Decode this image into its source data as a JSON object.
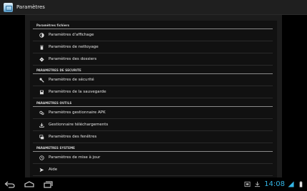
{
  "window": {
    "title": "Paramètres"
  },
  "sections": [
    {
      "header": "Paramètres fichiers",
      "items": [
        {
          "label": "Paramètres d'affichage",
          "icon": "display-icon"
        },
        {
          "label": "Paramètres de nettoyage",
          "icon": "trash-icon"
        },
        {
          "label": "Paramètres des dossiers",
          "icon": "folder-diamond-icon"
        }
      ]
    },
    {
      "header": "PARAMETRES DE SECURITE",
      "items": [
        {
          "label": "Paramètres de sécurité",
          "icon": "key-icon"
        },
        {
          "label": "Paramètres de la sauvegarde",
          "icon": "backup-icon"
        }
      ]
    },
    {
      "header": "PARAMETRES OUTILS",
      "items": [
        {
          "label": "Paramètres gestionnaire APK",
          "icon": "apk-gears-icon"
        },
        {
          "label": "Gestionnaire téléchargements",
          "icon": "download-icon"
        },
        {
          "label": "Paramètres des fenêtres",
          "icon": "windows-icon"
        }
      ]
    },
    {
      "header": "PARAMETRES SYSTEME",
      "items": [
        {
          "label": "Paramètres de mise à jour",
          "icon": "clock-icon"
        },
        {
          "label": "Aide",
          "icon": "send-arrow-icon"
        }
      ]
    }
  ],
  "statusbar": {
    "time": "14:08"
  },
  "colors": {
    "accent": "#33b5e5",
    "background": "#000000",
    "panel": "#1c1c1c"
  }
}
